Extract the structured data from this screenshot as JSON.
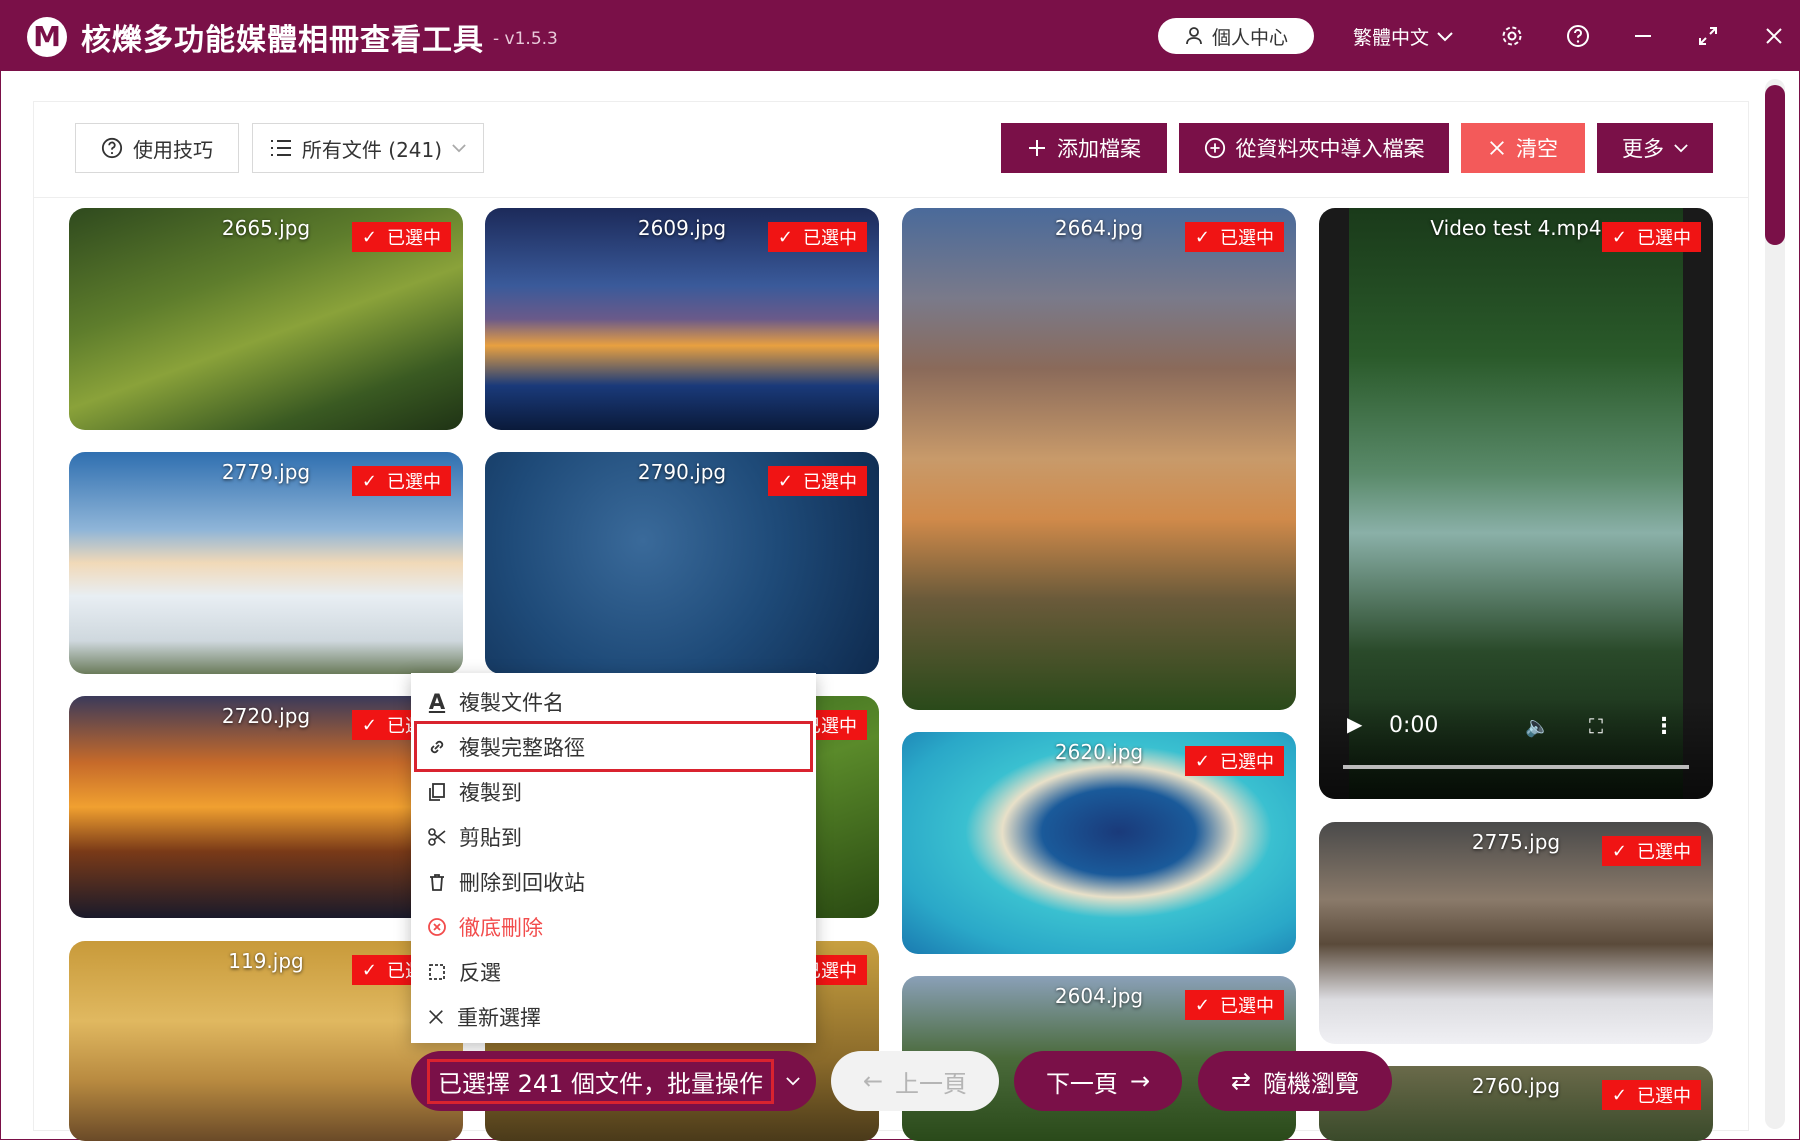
{
  "app": {
    "title": "核爍多功能媒體相冊查看工具",
    "version": "- v1.5.3",
    "logo_letter": "M"
  },
  "header": {
    "user_center": "個人中心",
    "language": "繁體中文"
  },
  "toolbar": {
    "tips_label": "使用技巧",
    "filter_label": "所有文件 (241)",
    "add_file_label": "添加檔案",
    "import_folder_label": "從資料夾中導入檔案",
    "clear_label": "清空",
    "more_label": "更多"
  },
  "selected_badge": "已選中",
  "thumbnails": [
    {
      "name": "2665.jpg"
    },
    {
      "name": "2609.jpg"
    },
    {
      "name": "2664.jpg"
    },
    {
      "name": "Video test 4.mp4"
    },
    {
      "name": "2779.jpg"
    },
    {
      "name": "2790.jpg"
    },
    {
      "name": "2720.jpg"
    },
    {
      "name": "2620.jpg"
    },
    {
      "name": "2775.jpg"
    },
    {
      "name": "119.jpg"
    },
    {
      "name": "2604.jpg"
    },
    {
      "name": "2760.jpg"
    }
  ],
  "video": {
    "time": "0:00"
  },
  "context_menu": {
    "items": [
      {
        "label": "複製文件名",
        "icon": "text-icon"
      },
      {
        "label": "複製完整路徑",
        "icon": "link-icon"
      },
      {
        "label": "複製到",
        "icon": "copy-icon"
      },
      {
        "label": "剪貼到",
        "icon": "scissors-icon"
      },
      {
        "label": "刪除到回收站",
        "icon": "trash-icon"
      },
      {
        "label": "徹底刪除",
        "icon": "x-circle-icon"
      },
      {
        "label": "反選",
        "icon": "invert-select-icon"
      },
      {
        "label": "重新選擇",
        "icon": "close-icon"
      }
    ]
  },
  "bottom_bar": {
    "batch_label": "已選擇 241 個文件，批量操作",
    "prev_label": "上一頁",
    "next_label": "下一頁",
    "random_label": "隨機瀏覽"
  },
  "colors": {
    "brand": "#7a1048",
    "selected_red": "#f01414",
    "clear_red": "#f35a5a",
    "highlight": "#d9232f"
  }
}
